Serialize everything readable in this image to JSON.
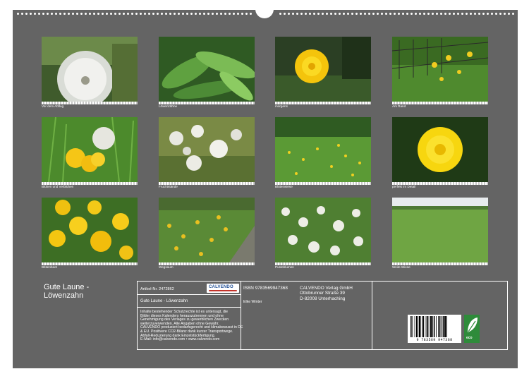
{
  "photos": [
    {
      "caption": "Vor dem Abflug"
    },
    {
      "caption": "Löwenzähne"
    },
    {
      "caption": "morgens"
    },
    {
      "caption": "Am Rand"
    },
    {
      "caption": "Blühen und Verblühen"
    },
    {
      "caption": "Fruchtstände"
    },
    {
      "caption": "Blütenwiese"
    },
    {
      "caption": "perfekt im Detail"
    },
    {
      "caption": "Blütenbeet"
    },
    {
      "caption": "Wegsaum"
    },
    {
      "caption": "Pusteblumen"
    },
    {
      "caption": "Weite Wiese"
    }
  ],
  "title": "Gute Laune - Löwenzahn",
  "info": {
    "article": "Artikel-Nr. 2472862",
    "logo": "CALVENDO",
    "calendar_title": "Gute Laune - Löwenzahn",
    "legal": [
      "Inhalte bestehender Schutzrechte ist es untersagt, die",
      "Bilder dieses Kalenders herauszutrennen und ohne",
      "Genehmigung des Verlages zu gewerblichen Zwecken",
      "weiterzuverwenden. Alle Angaben ohne Gewähr.",
      "CALVENDO produziert bedarfsgerecht und klimabewusst in DE",
      "& EU. Positivere CO2-Bilanz dank kurzer Transportwege.",
      "Abfall-Reduzierung dank Einzelstückfertigung.",
      "E-Mail: info@calvendo.com • www.calvendo.com"
    ],
    "isbn": "ISBN 9783569947368",
    "author": "Elke Winter",
    "publisher": [
      "CALVENDO Verlag GmbH",
      "Ottobrunner Straße 39",
      "D-82008 Unterhaching"
    ],
    "barcode_number": "9 783569 947368",
    "eco_label": "eco"
  },
  "colors": {
    "sheet": "#646464",
    "frame": "#ffffff"
  }
}
